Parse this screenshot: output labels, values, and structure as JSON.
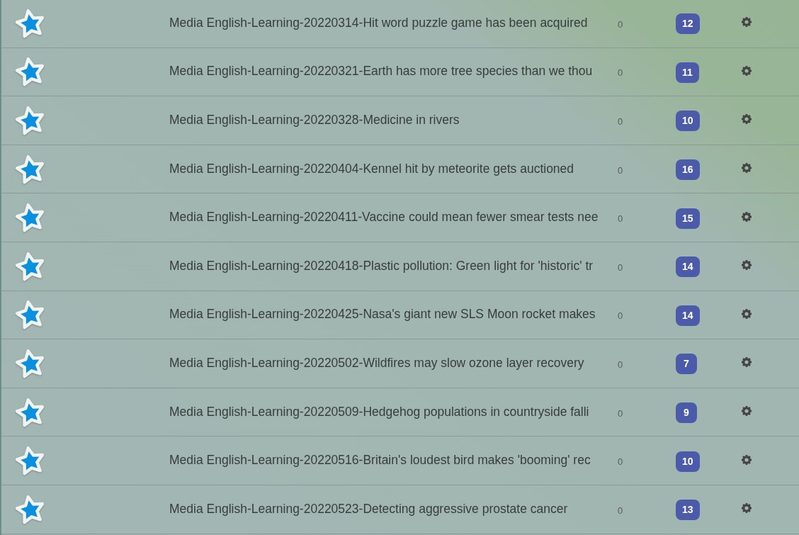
{
  "decks": [
    {
      "title": "Media English-Learning-20220314-Hit word puzzle game has been acquired",
      "count": "0",
      "badge": "12"
    },
    {
      "title": "Media English-Learning-20220321-Earth has more tree species than we thou",
      "count": "0",
      "badge": "11"
    },
    {
      "title": "Media English-Learning-20220328-Medicine in rivers",
      "count": "0",
      "badge": "10"
    },
    {
      "title": "Media English-Learning-20220404-Kennel hit by meteorite gets auctioned",
      "count": "0",
      "badge": "16"
    },
    {
      "title": "Media English-Learning-20220411-Vaccine could mean fewer smear tests nee",
      "count": "0",
      "badge": "15"
    },
    {
      "title": "Media English-Learning-20220418-Plastic pollution: Green light for 'historic' tr",
      "count": "0",
      "badge": "14"
    },
    {
      "title": "Media English-Learning-20220425-Nasa's giant new SLS Moon rocket makes",
      "count": "0",
      "badge": "14"
    },
    {
      "title": "Media English-Learning-20220502-Wildfires may slow ozone layer recovery",
      "count": "0",
      "badge": "7"
    },
    {
      "title": "Media English-Learning-20220509-Hedgehog populations in countryside falli",
      "count": "0",
      "badge": "9"
    },
    {
      "title": "Media English-Learning-20220516-Britain's loudest bird makes 'booming' rec",
      "count": "0",
      "badge": "10"
    },
    {
      "title": "Media English-Learning-20220523-Detecting aggressive prostate cancer",
      "count": "0",
      "badge": "13"
    }
  ]
}
